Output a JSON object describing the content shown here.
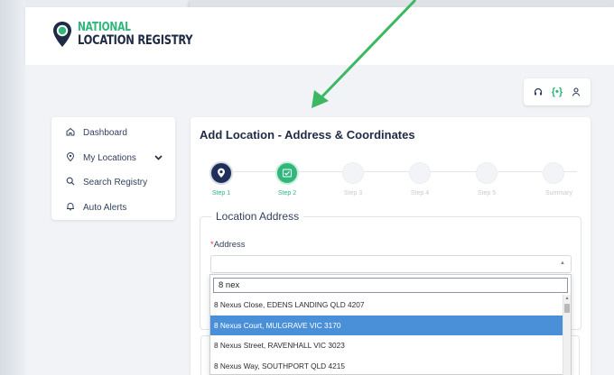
{
  "brand": {
    "line1": "NATIONAL",
    "line2": "LOCATION REGISTRY",
    "accent_color": "#2fb77c",
    "dark_color": "#1f2a44"
  },
  "utility_icons": [
    "headset-icon",
    "code-brackets-icon",
    "user-icon"
  ],
  "utility_symbol": "{•}",
  "sidebar": {
    "items": [
      {
        "label": "Dashboard",
        "icon": "home-icon"
      },
      {
        "label": "My Locations",
        "icon": "location-pin-icon",
        "expandable": true
      },
      {
        "label": "Search Registry",
        "icon": "search-icon"
      },
      {
        "label": "Auto Alerts",
        "icon": "bell-icon"
      }
    ]
  },
  "form": {
    "title": "Add Location - Address & Coordinates",
    "steps": [
      {
        "label": "Step 1",
        "state": "active"
      },
      {
        "label": "Step 2",
        "state": "done"
      },
      {
        "label": "Step 3",
        "state": "todo"
      },
      {
        "label": "Step 4",
        "state": "todo"
      },
      {
        "label": "Step 5",
        "state": "todo"
      },
      {
        "label": "Summary",
        "state": "todo"
      }
    ],
    "section_title": "Location Address",
    "address_label": "Address",
    "required_marker": "*",
    "address_value": ""
  },
  "dropdown": {
    "search_value": "8 nex",
    "options": [
      "8 Nexus Close, EDENS LANDING QLD 4207",
      "8 Nexus Court, MULGRAVE VIC 3170",
      "8 Nexus Street, RAVENHALL VIC 3023",
      "8 Nexus Way, SOUTHPORT QLD 4215"
    ],
    "selected_index": 1,
    "highlight_color": "#4a90d9"
  },
  "annotation": {
    "arrow_color": "#3cb862"
  }
}
